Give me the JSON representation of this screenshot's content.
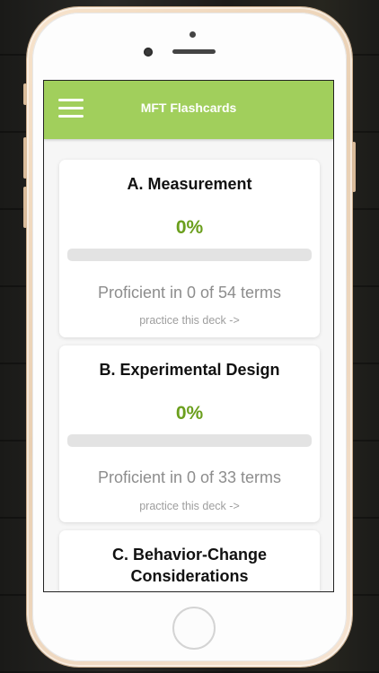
{
  "app": {
    "title": "MFT Flashcards",
    "accent_color": "#a1cf5c",
    "percent_color": "#6b9f1d",
    "menu_icon": "hamburger-menu-icon"
  },
  "decks": [
    {
      "title": "A. Measurement",
      "percent_label": "0%",
      "progress_fraction": 0,
      "proficient_text": "Proficient in 0 of 54 terms",
      "practice_label": "practice this deck ->"
    },
    {
      "title": "B. Experimental Design",
      "percent_label": "0%",
      "progress_fraction": 0,
      "proficient_text": "Proficient in 0 of 33 terms",
      "practice_label": "practice this deck ->"
    },
    {
      "title": "C. Behavior-Change Considerations"
    }
  ]
}
